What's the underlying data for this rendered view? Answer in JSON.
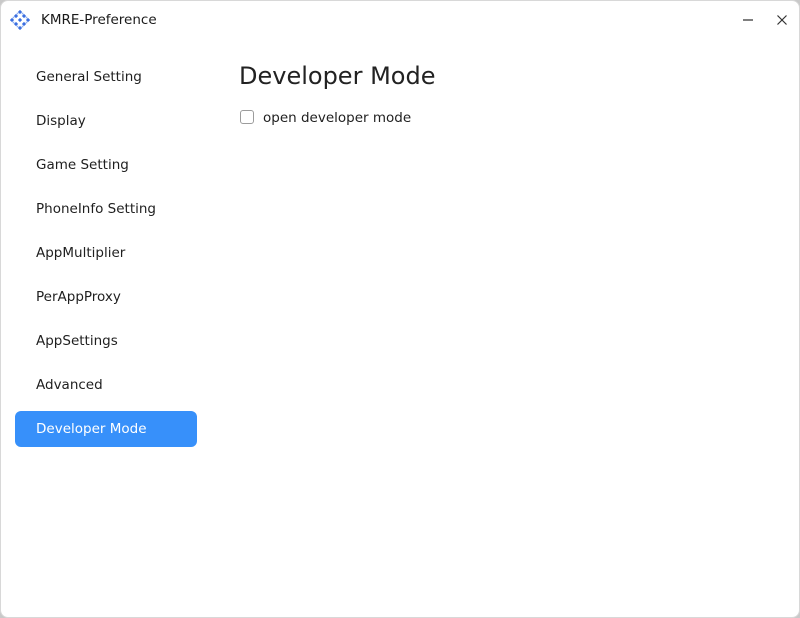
{
  "window": {
    "title": "KMRE-Preference",
    "icon": "kmre-app-icon",
    "minimize_icon": "minimize-icon",
    "close_icon": "close-icon"
  },
  "sidebar": {
    "items": [
      {
        "label": "General Setting",
        "active": false
      },
      {
        "label": "Display",
        "active": false
      },
      {
        "label": "Game Setting",
        "active": false
      },
      {
        "label": "PhoneInfo Setting",
        "active": false
      },
      {
        "label": "AppMultiplier",
        "active": false
      },
      {
        "label": "PerAppProxy",
        "active": false
      },
      {
        "label": "AppSettings",
        "active": false
      },
      {
        "label": "Advanced",
        "active": false
      },
      {
        "label": "Developer Mode",
        "active": true
      }
    ]
  },
  "main": {
    "title": "Developer Mode",
    "options": [
      {
        "label": "open developer mode",
        "checked": false
      }
    ]
  },
  "colors": {
    "accent": "#3790fa",
    "window_bg": "#ffffff",
    "text": "#1f1f1f"
  }
}
